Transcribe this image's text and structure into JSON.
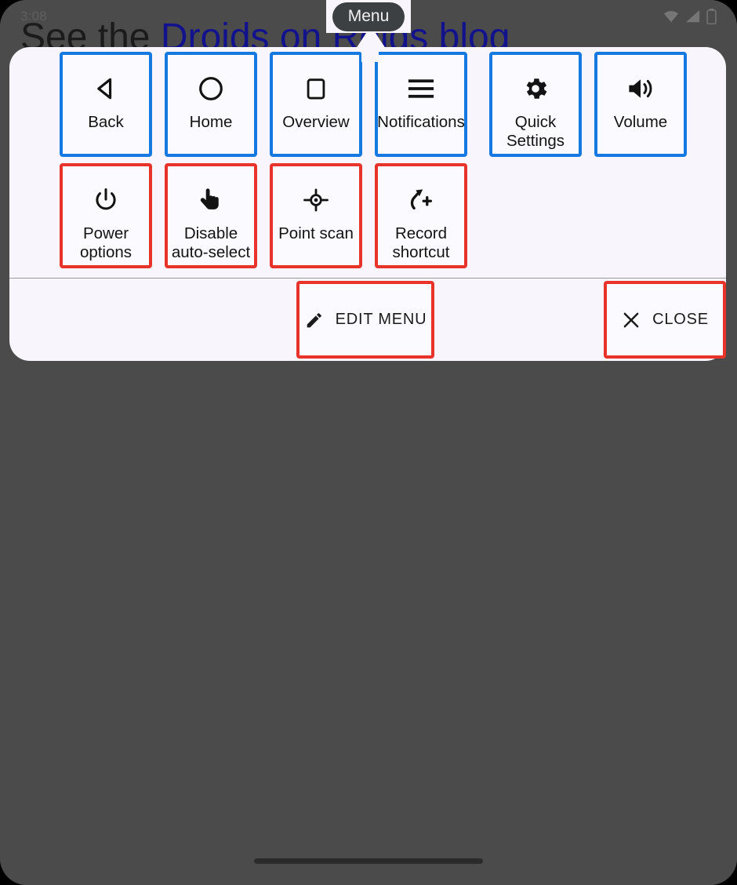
{
  "status_bar": {
    "time": "3:08",
    "icons": [
      "wifi-icon",
      "signal-icon",
      "battery-icon"
    ]
  },
  "background_page": {
    "heading_plain": "See the ",
    "heading_link": "Droids on Roids blog",
    "link_color": "#12128c"
  },
  "tooltip": {
    "label": "Menu",
    "bg_color": "#3c4043"
  },
  "accessibility_menu": {
    "panel_color": "#f8f6fc",
    "highlight_blue": "#1479e0",
    "highlight_red": "#e8332b",
    "row1": [
      {
        "label": "Back",
        "icon": "back-triangle-icon",
        "border": "blue"
      },
      {
        "label": "Home",
        "icon": "home-circle-icon",
        "border": "blue"
      },
      {
        "label": "Overview",
        "icon": "overview-square-icon",
        "border": "blue"
      },
      {
        "label": "Notifications",
        "icon": "notifications-lines-icon",
        "border": "blue"
      },
      {
        "label": "Quick Settings",
        "icon": "gear-icon",
        "border": "blue"
      },
      {
        "label": "Volume",
        "icon": "volume-speaker-icon",
        "border": "blue"
      }
    ],
    "row2": [
      {
        "label": "Power options",
        "icon": "power-icon",
        "border": "red"
      },
      {
        "label": "Disable auto-select",
        "icon": "tap-hand-icon",
        "border": "red"
      },
      {
        "label": "Point scan",
        "icon": "point-scan-icon",
        "border": "red"
      },
      {
        "label": "Record shortcut",
        "icon": "record-shortcut-icon",
        "border": "red"
      }
    ],
    "footer": {
      "edit_menu_label": "EDIT MENU",
      "edit_menu_icon": "pencil-icon",
      "close_label": "CLOSE",
      "close_icon": "close-x-icon"
    }
  },
  "navigation": {
    "gesture_bar": "home-gesture-bar"
  }
}
